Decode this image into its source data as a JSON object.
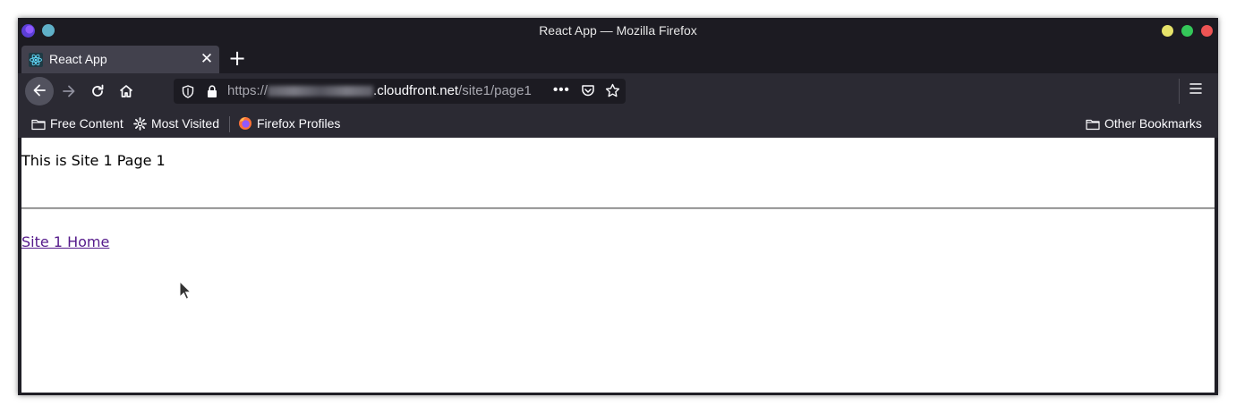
{
  "window": {
    "title": "React App — Mozilla Firefox"
  },
  "tab": {
    "title": "React App",
    "close_glyph": "✕",
    "new_tab_glyph": "+"
  },
  "urlbar": {
    "scheme": "https://",
    "domain_suffix": ".cloudfront.net",
    "path": "/site1/page1",
    "more_glyph": "•••"
  },
  "bookmarks": {
    "free_content": "Free Content",
    "most_visited": "Most Visited",
    "firefox_profiles": "Firefox Profiles",
    "other_bookmarks": "Other Bookmarks"
  },
  "page": {
    "heading": "This is Site 1 Page 1",
    "link_home": "Site 1 Home"
  },
  "colors": {
    "toolbar": "#2b2a33",
    "titlebar": "#1c1b22",
    "tab_active": "#42414d",
    "visited_link": "#551a8b"
  },
  "icons": [
    "firefox-icon",
    "react-favicon",
    "close-icon",
    "plus-icon",
    "back-arrow-icon",
    "forward-arrow-icon",
    "reload-icon",
    "home-icon",
    "shield-icon",
    "lock-icon",
    "more-icon",
    "pocket-icon",
    "star-icon",
    "hamburger-menu-icon",
    "folder-icon",
    "gear-icon",
    "mouse-cursor-icon"
  ]
}
